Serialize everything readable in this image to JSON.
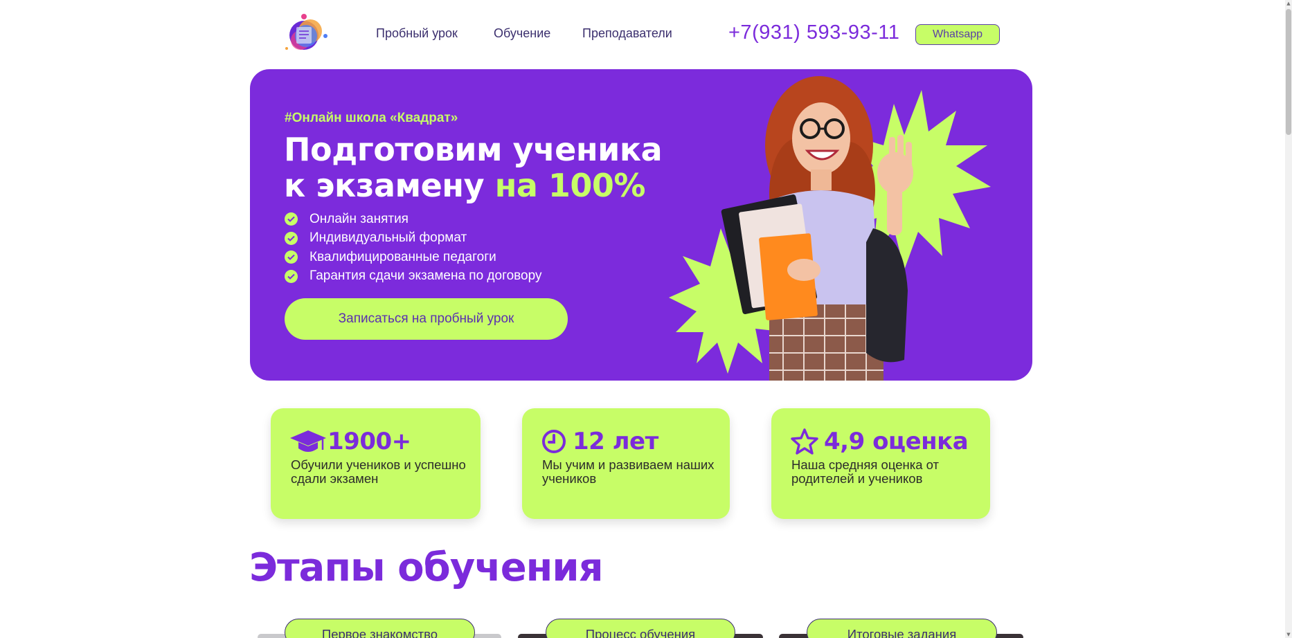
{
  "colors": {
    "brand_purple": "#7c2bdc",
    "accent_lime": "#c7fd67",
    "text_dark": "#2b2b2b"
  },
  "header": {
    "logo_icon": "school-logo",
    "nav": [
      "Пробный урок",
      "Обучение",
      "Преподаватели"
    ],
    "phone": "+7(931) 593-93-11",
    "whatsapp_label": "Whatsapp"
  },
  "hero": {
    "tag": "#Онлайн школа «Квадрат»",
    "title_line1": "Подготовим ученика",
    "title_line2": "к экзамену",
    "title_accent": "на 100%",
    "features": [
      "Онлайн занятия",
      "Индивидуальный формат",
      "Квалифицированные педагоги",
      "Гарантия сдачи экзамена по договору"
    ],
    "cta_label": "Записаться на пробный урок"
  },
  "stats": [
    {
      "icon": "graduation-cap-icon",
      "value": "1900+",
      "desc": "Обучили учеников и успешно сдали экзамен"
    },
    {
      "icon": "clock-icon",
      "value": "12 лет",
      "desc": "Мы учим и развиваем наших учеников"
    },
    {
      "icon": "star-icon",
      "value": "4,9 оценка",
      "desc": "Наша средняя оценка от родителей и учеников"
    }
  ],
  "stages": {
    "title": "Этапы обучения",
    "tabs": [
      "Первое знакомство",
      "Процесс обучения",
      "Итоговые задания"
    ]
  }
}
